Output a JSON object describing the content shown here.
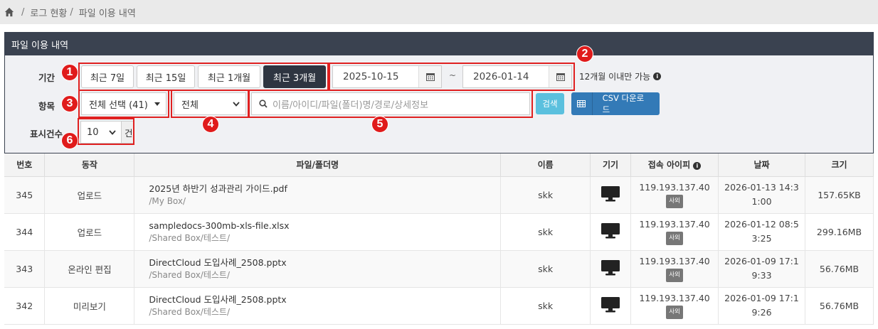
{
  "breadcrumb": {
    "items": [
      "로그 현황",
      "파일 이용 내역"
    ],
    "sep": "/"
  },
  "panel": {
    "title": "파일 이용 내역"
  },
  "period": {
    "label": "기간",
    "buttons": [
      "최근 7일",
      "최근 15일",
      "최근 1개월",
      "최근 3개월"
    ],
    "active_index": 3,
    "start_date": "2025-10-15",
    "tilde": "~",
    "end_date": "2026-01-14",
    "hint": "12개월 이내만 가능"
  },
  "item": {
    "label": "항목",
    "select_all": "전체 선택 (41)",
    "type_value": "전체",
    "search_placeholder": "이름/아이디/파일(폴더)명/경로/상세정보",
    "search_button": "검색",
    "csv_button": "CSV 다운로드"
  },
  "display": {
    "label": "표시건수",
    "value": "10",
    "suffix": "건"
  },
  "markers": [
    "1",
    "2",
    "3",
    "4",
    "5",
    "6"
  ],
  "table": {
    "headers": [
      "번호",
      "동작",
      "파일/폴더명",
      "이름",
      "기기",
      "접속 아이피",
      "날짜",
      "크기"
    ],
    "rows": [
      {
        "no": "345",
        "action": "업로드",
        "file": "2025년 하반기 성과관리 가이드.pdf",
        "path": "/My Box/",
        "name": "skk",
        "device": "desktop-icon",
        "ip": "119.193.137.40",
        "badge": "사외",
        "date": "2026-01-13 14:31:00",
        "size": "157.65KB"
      },
      {
        "no": "344",
        "action": "업로드",
        "file": "sampledocs-300mb-xls-file.xlsx",
        "path": "/Shared Box/테스트/",
        "name": "skk",
        "device": "desktop-icon",
        "ip": "119.193.137.40",
        "badge": "사외",
        "date": "2026-01-12 08:53:25",
        "size": "299.16MB"
      },
      {
        "no": "343",
        "action": "온라인 편집",
        "file": "DirectCloud 도입사례_2508.pptx",
        "path": "/Shared Box/테스트/",
        "name": "skk",
        "device": "desktop-icon",
        "ip": "119.193.137.40",
        "badge": "사외",
        "date": "2026-01-09 17:19:33",
        "size": "56.76MB"
      },
      {
        "no": "342",
        "action": "미리보기",
        "file": "DirectCloud 도입사례_2508.pptx",
        "path": "/Shared Box/테스트/",
        "name": "skk",
        "device": "desktop-icon",
        "ip": "119.193.137.40",
        "badge": "사외",
        "date": "2026-01-09 17:19:26",
        "size": "56.76MB"
      }
    ]
  }
}
